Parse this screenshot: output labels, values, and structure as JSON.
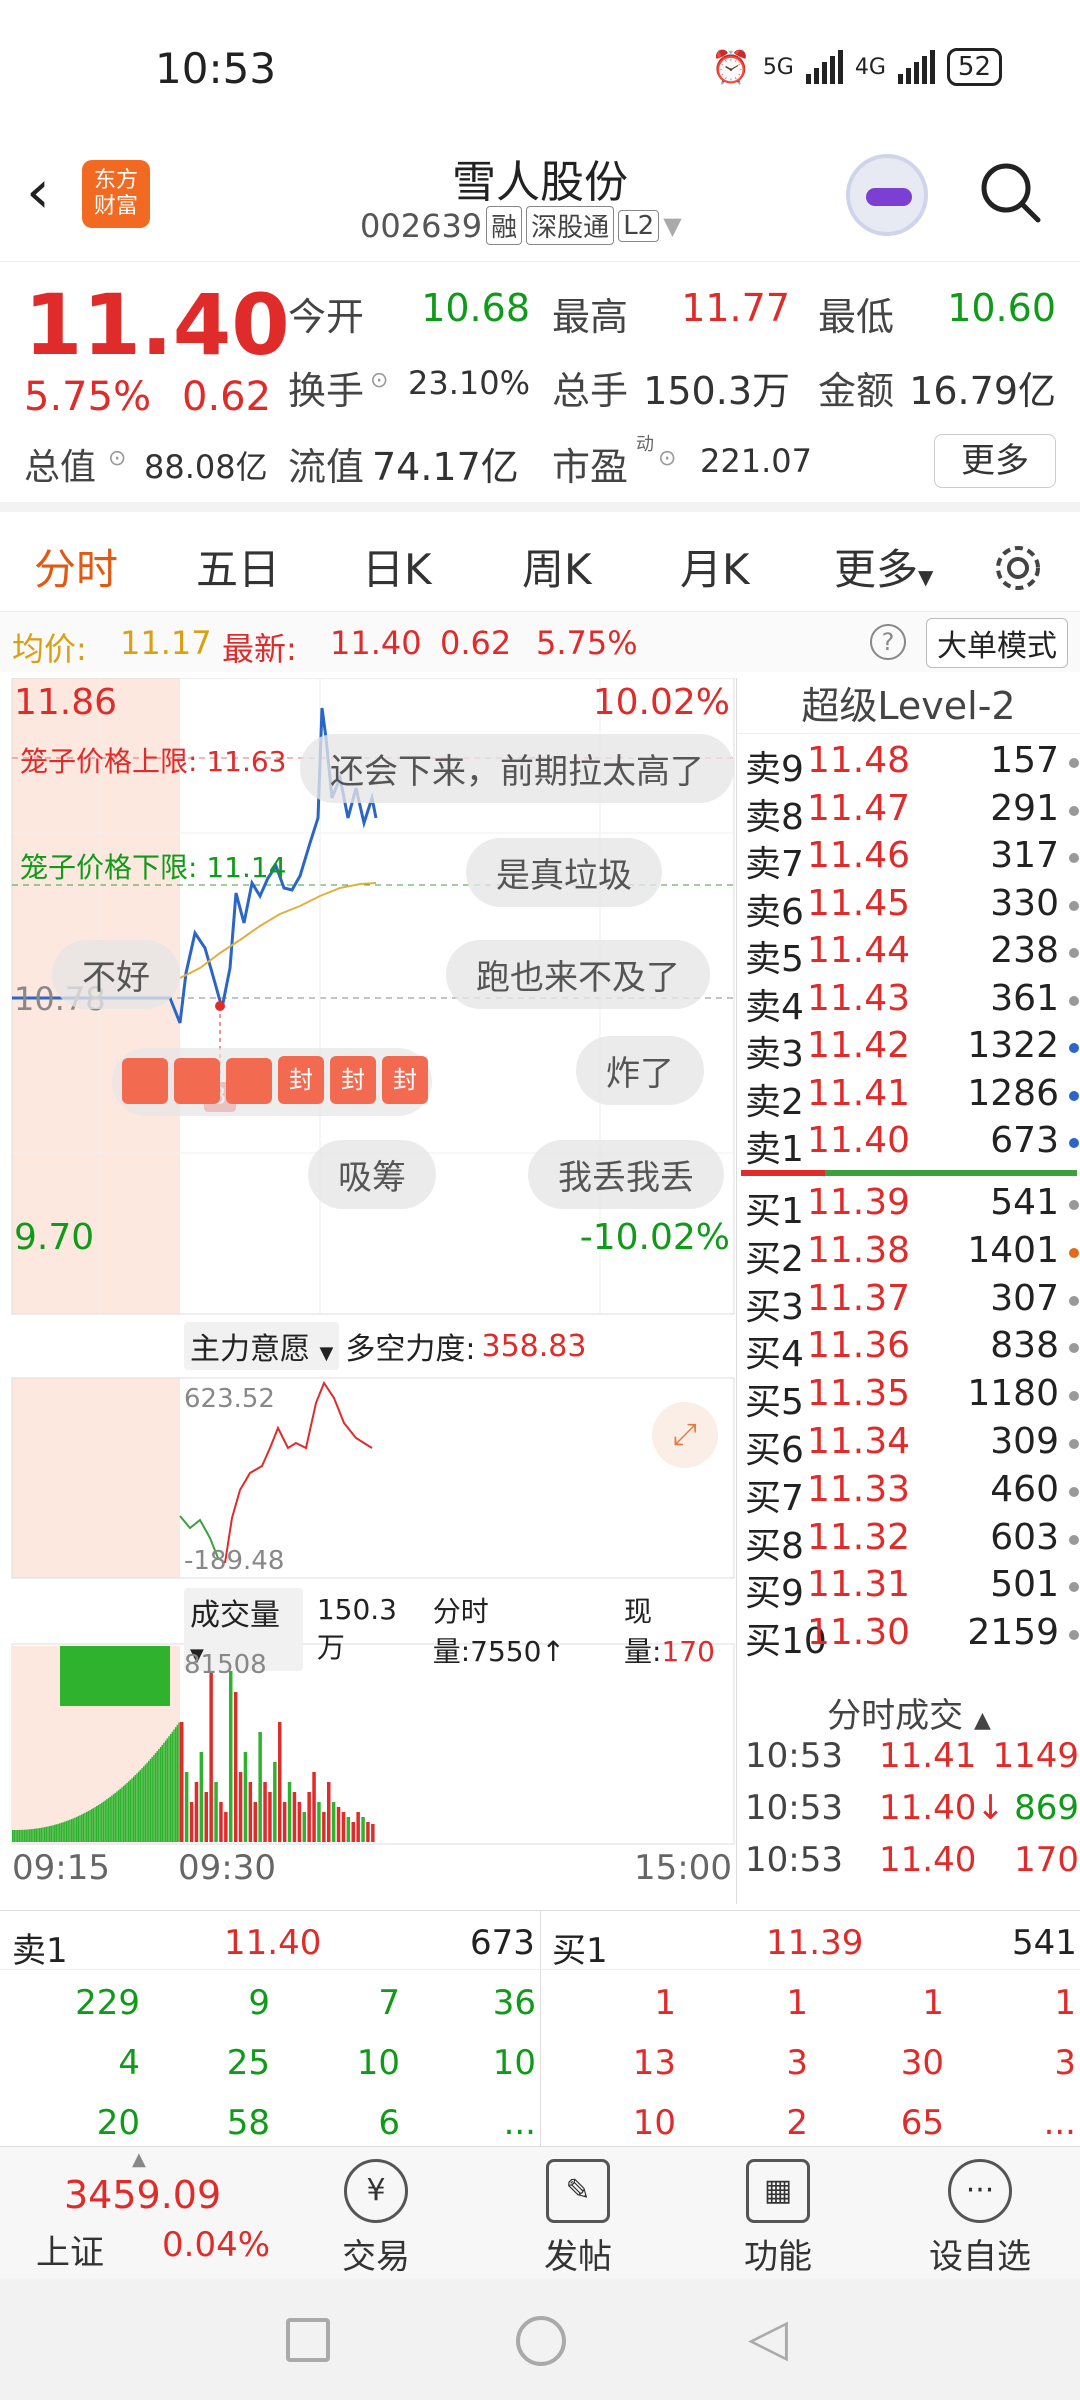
{
  "status": {
    "time": "10:53",
    "battery": "52",
    "net1": "5G",
    "net2": "4G"
  },
  "header": {
    "title": "雪人股份",
    "code": "002639",
    "tags": [
      "融",
      "深股通",
      "L2"
    ],
    "logo": "东方\n财富"
  },
  "quote": {
    "price": "11.40",
    "pct": "5.75%",
    "change": "0.62",
    "open_label": "今开",
    "open": "10.68",
    "high_label": "最高",
    "high": "11.77",
    "low_label": "最低",
    "low": "10.60",
    "turnover_label": "换手",
    "turnover": "23.10%",
    "volume_label": "总手",
    "volume": "150.3万",
    "amount_label": "金额",
    "amount": "16.79亿",
    "mcap_label": "总值",
    "mcap": "88.08亿",
    "float_label": "流值",
    "float": "74.17亿",
    "pe_label": "市盈",
    "pe_sup": "动",
    "pe": "221.07",
    "more": "更多"
  },
  "tabs": [
    "分时",
    "五日",
    "日K",
    "周K",
    "月K",
    "更多"
  ],
  "avgbar": {
    "avg_label": "均价:",
    "avg": "11.17",
    "latest_label": "最新:",
    "latest": "11.40",
    "chg": "0.62",
    "pct": "5.75%",
    "big_mode": "大单模式"
  },
  "chart": {
    "top_price": "11.86",
    "top_pct": "10.02%",
    "bottom_price": "9.70",
    "bottom_pct": "-10.02%",
    "upper_limit": "笼子价格上限: 11.63",
    "lower_limit": "笼子价格下限: 11.14",
    "ref_price": "10.78",
    "buy_marker": "B",
    "ind_name": "主力意愿",
    "ind_label": "多空力度:",
    "ind_value": "358.83",
    "ind_top": "623.52",
    "ind_bottom": "-189.48",
    "vol_name": "成交量",
    "vol_total": "150.3万",
    "vol_fen_label": "分时量:",
    "vol_fen": "7550",
    "vol_now_label": "现量:",
    "vol_now": "170",
    "vol_max": "81508",
    "time_start": "09:15",
    "time_mid": "09:30",
    "time_end": "15:00",
    "comments": [
      "还会下来，前期拉太高了",
      "是真垃圾",
      "不好",
      "跑也来不及了",
      "炸了",
      "吸筹",
      "我丢我丢"
    ],
    "chips": [
      "封",
      "封",
      "封"
    ]
  },
  "orderbook": {
    "title": "超级Level-2",
    "sells": [
      {
        "label": "卖9",
        "price": "11.48",
        "vol": "157"
      },
      {
        "label": "卖8",
        "price": "11.47",
        "vol": "291"
      },
      {
        "label": "卖7",
        "price": "11.46",
        "vol": "317"
      },
      {
        "label": "卖6",
        "price": "11.45",
        "vol": "330"
      },
      {
        "label": "卖5",
        "price": "11.44",
        "vol": "238"
      },
      {
        "label": "卖4",
        "price": "11.43",
        "vol": "361"
      },
      {
        "label": "卖3",
        "price": "11.42",
        "vol": "1322"
      },
      {
        "label": "卖2",
        "price": "11.41",
        "vol": "1286"
      },
      {
        "label": "卖1",
        "price": "11.40",
        "vol": "673"
      }
    ],
    "buys": [
      {
        "label": "买1",
        "price": "11.39",
        "vol": "541"
      },
      {
        "label": "买2",
        "price": "11.38",
        "vol": "1401"
      },
      {
        "label": "买3",
        "price": "11.37",
        "vol": "307"
      },
      {
        "label": "买4",
        "price": "11.36",
        "vol": "838"
      },
      {
        "label": "买5",
        "price": "11.35",
        "vol": "1180"
      },
      {
        "label": "买6",
        "price": "11.34",
        "vol": "309"
      },
      {
        "label": "买7",
        "price": "11.33",
        "vol": "460"
      },
      {
        "label": "买8",
        "price": "11.32",
        "vol": "603"
      },
      {
        "label": "买9",
        "price": "11.31",
        "vol": "501"
      },
      {
        "label": "买10",
        "price": "11.30",
        "vol": "2159"
      }
    ],
    "trades_title": "分时成交",
    "trades": [
      {
        "time": "10:53",
        "price": "11.41",
        "vol": "1149"
      },
      {
        "time": "10:53",
        "price": "11.40↓",
        "vol": "869"
      },
      {
        "time": "10:53",
        "price": "11.40",
        "vol": "170"
      }
    ]
  },
  "queue": {
    "sell_label": "卖1",
    "sell_price": "11.40",
    "sell_vol": "673",
    "buy_label": "买1",
    "buy_price": "11.39",
    "buy_vol": "541",
    "sell_rows": [
      [
        "229",
        "9",
        "7",
        "36"
      ],
      [
        "4",
        "25",
        "10",
        "10"
      ],
      [
        "20",
        "58",
        "6",
        "..."
      ]
    ],
    "buy_rows": [
      [
        "1",
        "1",
        "1",
        "1"
      ],
      [
        "13",
        "3",
        "30",
        "3"
      ],
      [
        "10",
        "2",
        "65",
        "..."
      ]
    ]
  },
  "nav": {
    "index_value": "3459.09",
    "index_name": "上证",
    "index_pct": "0.04%",
    "items": [
      "交易",
      "发帖",
      "功能",
      "设自选"
    ]
  },
  "colors": {
    "up": "#e02b2b",
    "down": "#109a1a",
    "accent": "#e25a12"
  }
}
